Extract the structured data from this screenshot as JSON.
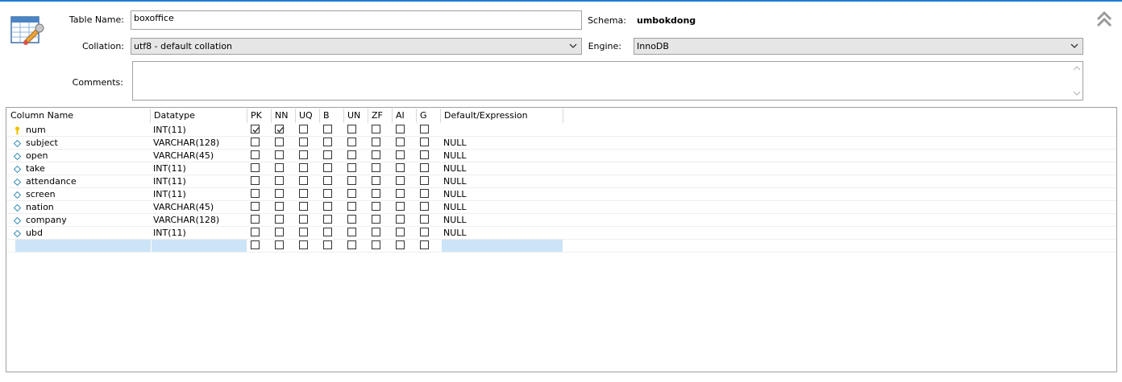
{
  "form": {
    "table_name_label": "Table Name:",
    "table_name_value": "boxoffice",
    "schema_label": "Schema:",
    "schema_value": "umbokdong",
    "collation_label": "Collation:",
    "collation_value": "utf8 - default collation",
    "engine_label": "Engine:",
    "engine_value": "InnoDB",
    "comments_label": "Comments:",
    "comments_value": ""
  },
  "grid": {
    "headers": [
      "Column Name",
      "Datatype",
      "PK",
      "NN",
      "UQ",
      "B",
      "UN",
      "ZF",
      "AI",
      "G",
      "Default/Expression"
    ],
    "rows": [
      {
        "name": "num",
        "type": "INT(11)",
        "key": true,
        "flags": [
          true,
          true,
          false,
          false,
          false,
          false,
          false,
          false
        ],
        "default": ""
      },
      {
        "name": "subject",
        "type": "VARCHAR(128)",
        "key": false,
        "flags": [
          false,
          false,
          false,
          false,
          false,
          false,
          false,
          false
        ],
        "default": "NULL"
      },
      {
        "name": "open",
        "type": "VARCHAR(45)",
        "key": false,
        "flags": [
          false,
          false,
          false,
          false,
          false,
          false,
          false,
          false
        ],
        "default": "NULL"
      },
      {
        "name": "take",
        "type": "INT(11)",
        "key": false,
        "flags": [
          false,
          false,
          false,
          false,
          false,
          false,
          false,
          false
        ],
        "default": "NULL"
      },
      {
        "name": "attendance",
        "type": "INT(11)",
        "key": false,
        "flags": [
          false,
          false,
          false,
          false,
          false,
          false,
          false,
          false
        ],
        "default": "NULL"
      },
      {
        "name": "screen",
        "type": "INT(11)",
        "key": false,
        "flags": [
          false,
          false,
          false,
          false,
          false,
          false,
          false,
          false
        ],
        "default": "NULL"
      },
      {
        "name": "nation",
        "type": "VARCHAR(45)",
        "key": false,
        "flags": [
          false,
          false,
          false,
          false,
          false,
          false,
          false,
          false
        ],
        "default": "NULL"
      },
      {
        "name": "company",
        "type": "VARCHAR(128)",
        "key": false,
        "flags": [
          false,
          false,
          false,
          false,
          false,
          false,
          false,
          false
        ],
        "default": "NULL"
      },
      {
        "name": "ubd",
        "type": "INT(11)",
        "key": false,
        "flags": [
          false,
          false,
          false,
          false,
          false,
          false,
          false,
          false
        ],
        "default": "NULL"
      }
    ]
  },
  "icons": {
    "table_editor": "table-editor-icon",
    "collapse": "double-chevron-up-icon",
    "primary_key": "key-icon",
    "column": "diamond-icon"
  },
  "colors": {
    "accent": "#1e7fd6",
    "selection": "#cce4f7",
    "key": "#f2c200",
    "diamond": "#3a8fb7"
  }
}
